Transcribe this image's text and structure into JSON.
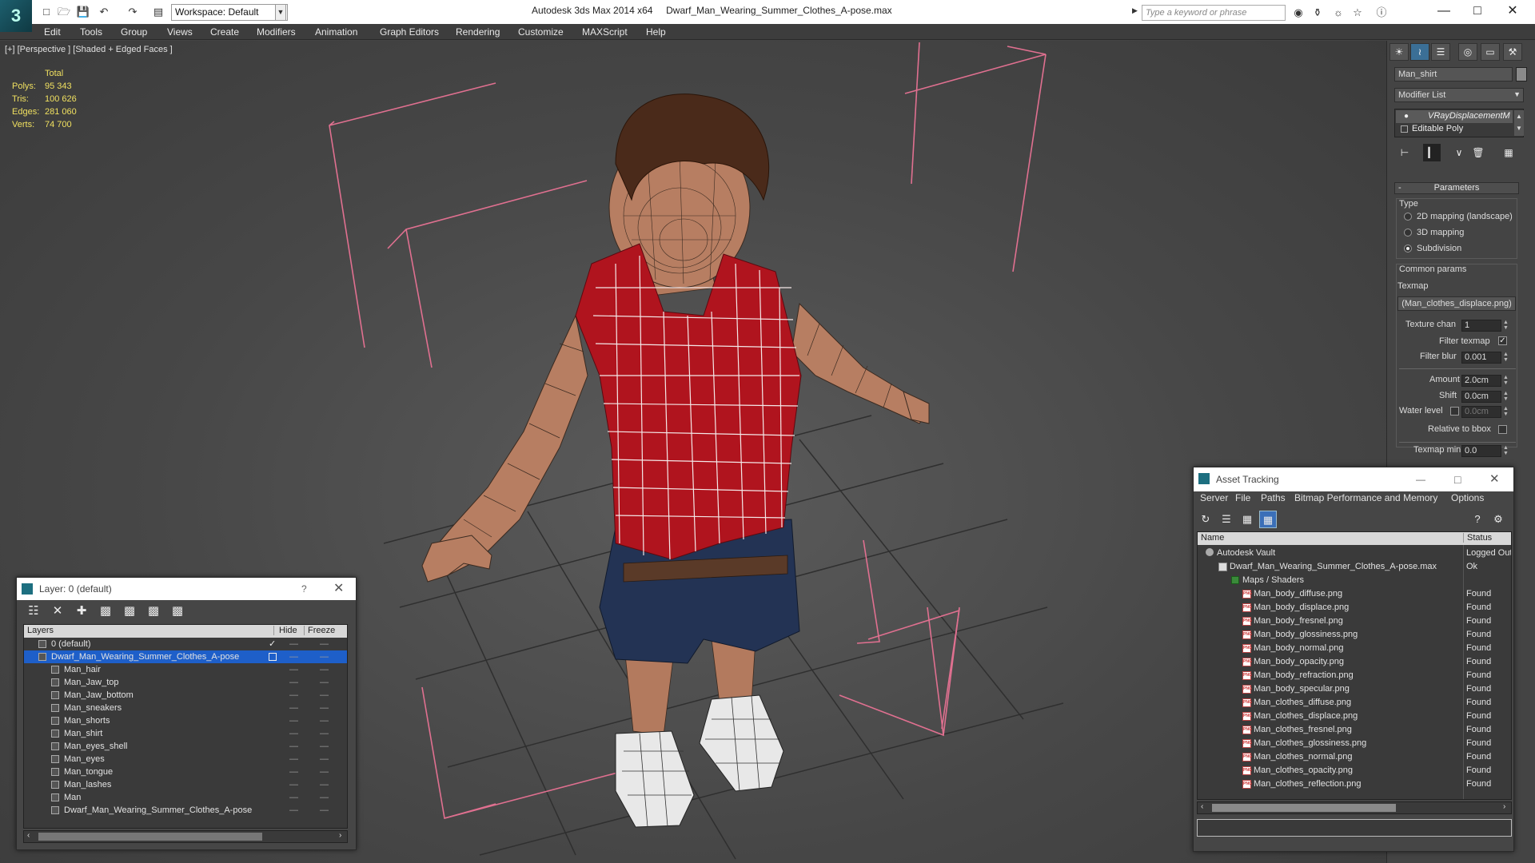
{
  "titlebar": {
    "app_title": "Autodesk 3ds Max  2014 x64",
    "file_name": "Dwarf_Man_Wearing_Summer_Clothes_A-pose.max",
    "workspace_label": "Workspace: Default",
    "search_placeholder": "Type a keyword or phrase"
  },
  "menu": [
    "Edit",
    "Tools",
    "Group",
    "Views",
    "Create",
    "Modifiers",
    "Animation",
    "Graph Editors",
    "Rendering",
    "Customize",
    "MAXScript",
    "Help"
  ],
  "viewport": {
    "label": "[+] [Perspective ] [Shaded + Edged Faces ]",
    "stats": {
      "total_label": "Total",
      "rows": [
        {
          "label": "Polys:",
          "value": "95 343"
        },
        {
          "label": "Tris:",
          "value": "100 626"
        },
        {
          "label": "Edges:",
          "value": "281 060"
        },
        {
          "label": "Verts:",
          "value": "74 700"
        }
      ]
    }
  },
  "command_panel": {
    "object_name": "Man_shirt",
    "modifier_list": "Modifier List",
    "stack": [
      "VRayDisplacementM",
      "Editable Poly"
    ],
    "rollout_title": "Parameters",
    "type_label": "Type",
    "type_options": [
      "2D mapping (landscape)",
      "3D mapping",
      "Subdivision"
    ],
    "type_selected_index": 2,
    "common_params": "Common params",
    "texmap_label": "Texmap",
    "texmap_value": "(Man_clothes_displace.png)",
    "texture_chan_label": "Texture chan",
    "texture_chan_value": "1",
    "filter_texmap_label": "Filter texmap",
    "filter_blur_label": "Filter blur",
    "filter_blur_value": "0.001",
    "amount_label": "Amount",
    "amount_value": "2.0cm",
    "shift_label": "Shift",
    "shift_value": "0.0cm",
    "water_level_label": "Water level",
    "water_level_value": "0.0cm",
    "relative_bbox_label": "Relative to bbox",
    "texmap_min_label": "Texmap min",
    "texmap_min_value": "0.0"
  },
  "layer_window": {
    "title": "Layer: 0 (default)",
    "help": "?",
    "col_layers": "Layers",
    "col_hide": "Hide",
    "col_freeze": "Freeze",
    "rows": [
      {
        "name": "0 (default)",
        "indent": 1,
        "selected": false
      },
      {
        "name": "Dwarf_Man_Wearing_Summer_Clothes_A-pose",
        "indent": 1,
        "selected": true
      },
      {
        "name": "Man_hair",
        "indent": 2,
        "selected": false
      },
      {
        "name": "Man_Jaw_top",
        "indent": 2,
        "selected": false
      },
      {
        "name": "Man_Jaw_bottom",
        "indent": 2,
        "selected": false
      },
      {
        "name": "Man_sneakers",
        "indent": 2,
        "selected": false
      },
      {
        "name": "Man_shorts",
        "indent": 2,
        "selected": false
      },
      {
        "name": "Man_shirt",
        "indent": 2,
        "selected": false
      },
      {
        "name": "Man_eyes_shell",
        "indent": 2,
        "selected": false
      },
      {
        "name": "Man_eyes",
        "indent": 2,
        "selected": false
      },
      {
        "name": "Man_tongue",
        "indent": 2,
        "selected": false
      },
      {
        "name": "Man_lashes",
        "indent": 2,
        "selected": false
      },
      {
        "name": "Man",
        "indent": 2,
        "selected": false
      },
      {
        "name": "Dwarf_Man_Wearing_Summer_Clothes_A-pose",
        "indent": 2,
        "selected": false
      }
    ]
  },
  "asset_window": {
    "title": "Asset Tracking",
    "menus": [
      "Server",
      "File",
      "Paths",
      "Bitmap Performance and Memory",
      "Options"
    ],
    "col_name": "Name",
    "col_status": "Status",
    "rows": [
      {
        "name": "Autodesk Vault",
        "status": "Logged Out",
        "level": 0,
        "icon": "vault"
      },
      {
        "name": "Dwarf_Man_Wearing_Summer_Clothes_A-pose.max",
        "status": "Ok",
        "level": 1,
        "icon": "max"
      },
      {
        "name": "Maps / Shaders",
        "status": "",
        "level": 2,
        "icon": "maps"
      },
      {
        "name": "Man_body_diffuse.png",
        "status": "Found",
        "level": 3,
        "icon": "png"
      },
      {
        "name": "Man_body_displace.png",
        "status": "Found",
        "level": 3,
        "icon": "png"
      },
      {
        "name": "Man_body_fresnel.png",
        "status": "Found",
        "level": 3,
        "icon": "png"
      },
      {
        "name": "Man_body_glossiness.png",
        "status": "Found",
        "level": 3,
        "icon": "png"
      },
      {
        "name": "Man_body_normal.png",
        "status": "Found",
        "level": 3,
        "icon": "png"
      },
      {
        "name": "Man_body_opacity.png",
        "status": "Found",
        "level": 3,
        "icon": "png"
      },
      {
        "name": "Man_body_refraction.png",
        "status": "Found",
        "level": 3,
        "icon": "png"
      },
      {
        "name": "Man_body_specular.png",
        "status": "Found",
        "level": 3,
        "icon": "png"
      },
      {
        "name": "Man_clothes_diffuse.png",
        "status": "Found",
        "level": 3,
        "icon": "png"
      },
      {
        "name": "Man_clothes_displace.png",
        "status": "Found",
        "level": 3,
        "icon": "png"
      },
      {
        "name": "Man_clothes_fresnel.png",
        "status": "Found",
        "level": 3,
        "icon": "png"
      },
      {
        "name": "Man_clothes_glossiness.png",
        "status": "Found",
        "level": 3,
        "icon": "png"
      },
      {
        "name": "Man_clothes_normal.png",
        "status": "Found",
        "level": 3,
        "icon": "png"
      },
      {
        "name": "Man_clothes_opacity.png",
        "status": "Found",
        "level": 3,
        "icon": "png"
      },
      {
        "name": "Man_clothes_reflection.png",
        "status": "Found",
        "level": 3,
        "icon": "png"
      }
    ]
  },
  "colors": {
    "selection": "#1e5fc9",
    "stats": "#f0e060",
    "bbox_lines": "#e07090",
    "shirt": "#b0141e",
    "skin": "#b77e62",
    "shorts": "#22324e"
  }
}
